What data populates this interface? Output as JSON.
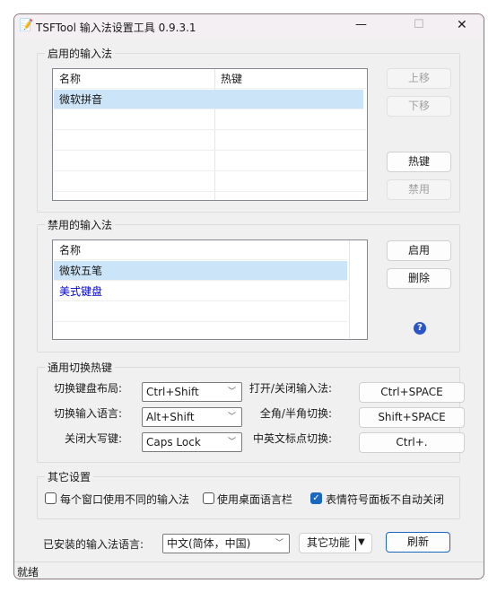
{
  "window": {
    "title": "TSFTool 输入法设置工具 0.9.3.1",
    "minimize": "—",
    "maximize": "☐",
    "close": "✕"
  },
  "enabled": {
    "legend": "启用的输入法",
    "columns": [
      "名称",
      "热键"
    ],
    "rows": [
      {
        "name": "微软拼音",
        "hotkey": ""
      }
    ],
    "buttons": {
      "up": "上移",
      "down": "下移",
      "hotkey": "热键",
      "disable": "禁用"
    }
  },
  "disabled": {
    "legend": "禁用的输入法",
    "column": "名称",
    "rows": [
      "微软五笔",
      "美式键盘"
    ],
    "buttons": {
      "enable": "启用",
      "delete": "删除"
    },
    "help": "?"
  },
  "hotkeys": {
    "legend": "通用切换热键",
    "left": [
      {
        "label": "切换键盘布局:",
        "value": "Ctrl+Shift"
      },
      {
        "label": "切换输入语言:",
        "value": "Alt+Shift"
      },
      {
        "label": "关闭大写键:",
        "value": "Caps Lock"
      }
    ],
    "right": [
      {
        "label": "打开/关闭输入法:",
        "value": "Ctrl+SPACE"
      },
      {
        "label": "全角/半角切换:",
        "value": "Shift+SPACE"
      },
      {
        "label": "中英文标点切换:",
        "value": "Ctrl+."
      }
    ]
  },
  "other": {
    "legend": "其它设置",
    "options": [
      {
        "label": "每个窗口使用不同的输入法",
        "checked": false
      },
      {
        "label": "使用桌面语言栏",
        "checked": false
      },
      {
        "label": "表情符号面板不自动关闭",
        "checked": true
      }
    ]
  },
  "bottom": {
    "lang_label": "已安装的输入法语言:",
    "lang_value": "中文(简体，中国)",
    "more": "其它功能",
    "refresh": "刷新"
  },
  "status": "就绪",
  "colors": {
    "selected": "#cce4f7",
    "link_blue": "#0000e0",
    "accent": "#1a67c0"
  }
}
